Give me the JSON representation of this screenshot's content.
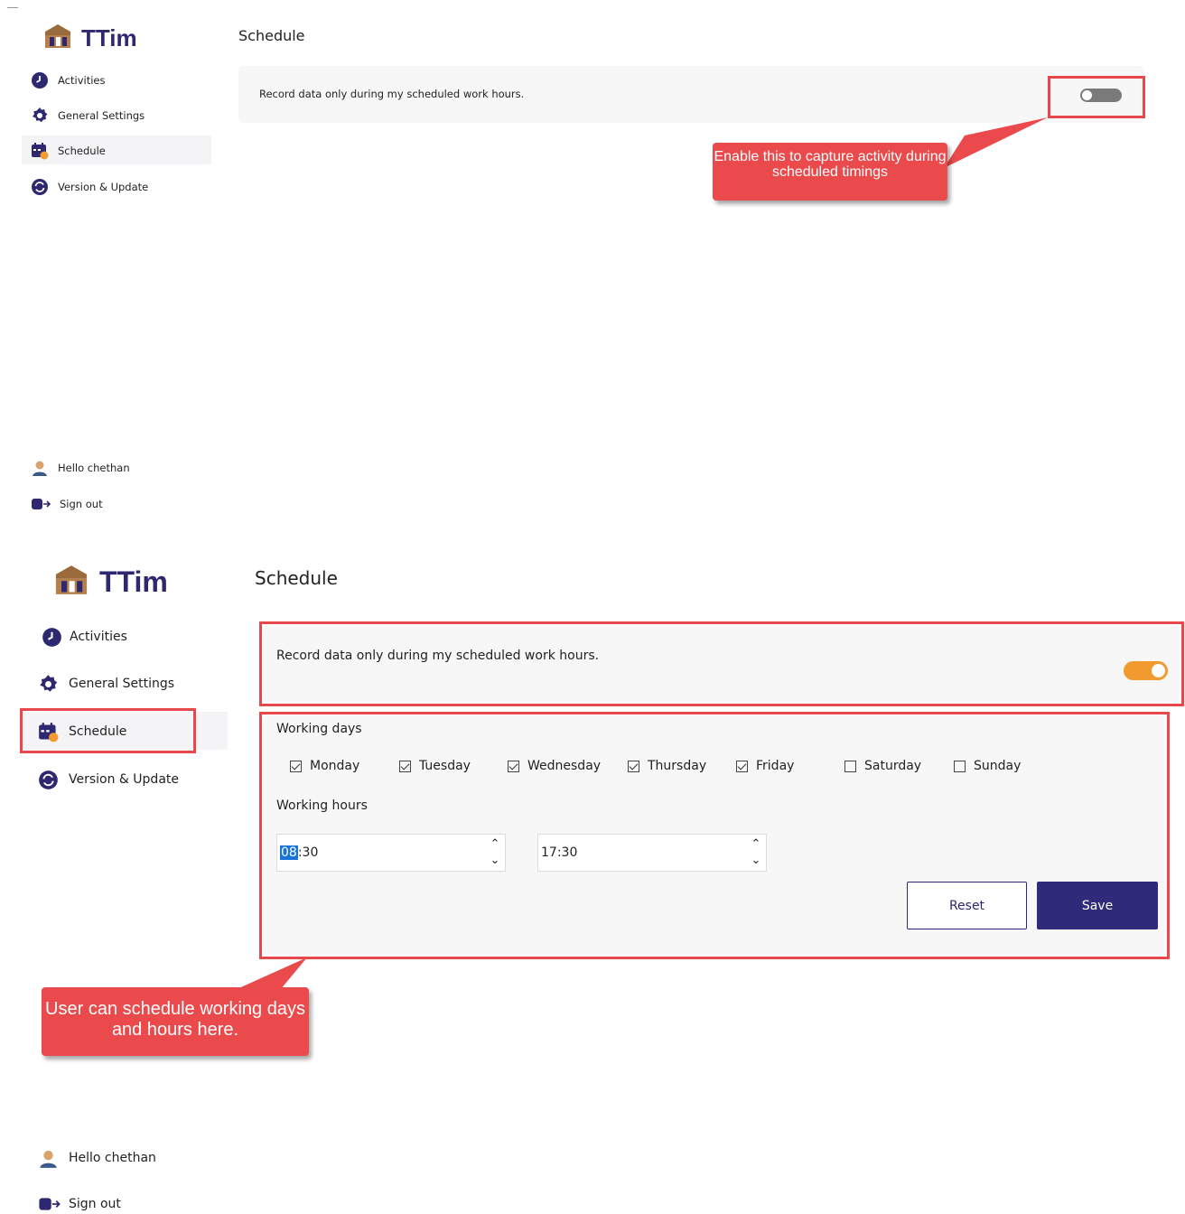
{
  "brand": {
    "name": "TTim"
  },
  "nav": [
    {
      "key": "activities",
      "label": "Activities"
    },
    {
      "key": "general",
      "label": "General Settings"
    },
    {
      "key": "schedule",
      "label": "Schedule"
    },
    {
      "key": "version",
      "label": "Version & Update"
    }
  ],
  "footer": {
    "greeting": "Hello chethan",
    "signout": "Sign out"
  },
  "page": {
    "title": "Schedule"
  },
  "record_toggle": {
    "label": "Record data only during my scheduled work hours.",
    "top_state": "off",
    "bottom_state": "on"
  },
  "working_days": {
    "heading": "Working days",
    "days": [
      {
        "label": "Monday",
        "checked": true
      },
      {
        "label": "Tuesday",
        "checked": true
      },
      {
        "label": "Wednesday",
        "checked": true
      },
      {
        "label": "Thursday",
        "checked": true
      },
      {
        "label": "Friday",
        "checked": true
      },
      {
        "label": "Saturday",
        "checked": false
      },
      {
        "label": "Sunday",
        "checked": false
      }
    ]
  },
  "working_hours": {
    "heading": "Working hours",
    "start": {
      "hour": "08",
      "rest": ":30"
    },
    "end": "17:30"
  },
  "buttons": {
    "reset": "Reset",
    "save": "Save"
  },
  "callouts": {
    "toggle_hint": "Enable this to capture activity during scheduled timings",
    "schedule_hint": "User can schedule working days and hours here."
  },
  "colors": {
    "accent": "#f29a2e",
    "brand": "#2e2870",
    "save_button": "#2f2a7a",
    "annotation_red": "#e8474b",
    "toggle_off": "#7a7a7a"
  }
}
